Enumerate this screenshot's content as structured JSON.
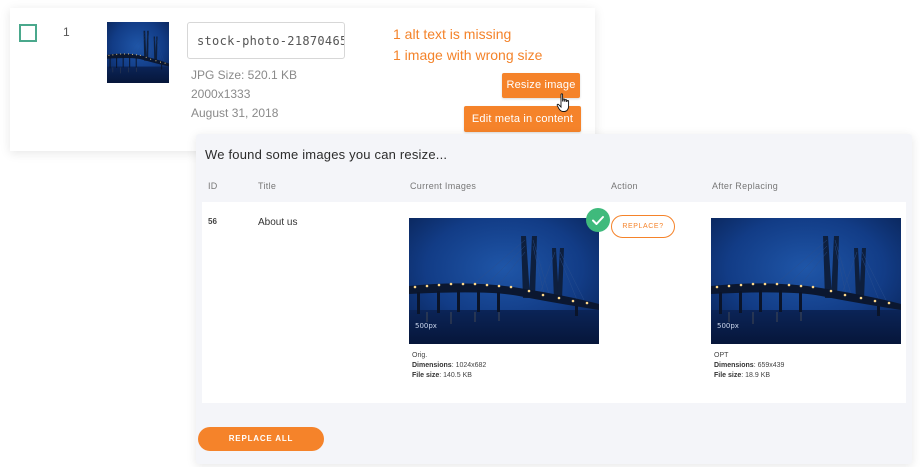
{
  "media_row": {
    "id": "1",
    "filename": "stock-photo-21870465",
    "file_size": "JPG Size: 520.1 KB",
    "dimensions": "2000x1333",
    "date": "August 31, 2018",
    "warnings": [
      "1 alt text is missing",
      "1 image with wrong size"
    ],
    "resize_button": "Resize image",
    "edit_meta_button": "Edit meta in content"
  },
  "resize_panel": {
    "title": "We found some images you can resize...",
    "columns": [
      "ID",
      "Title",
      "Current Images",
      "Action",
      "After Replacing"
    ],
    "row": {
      "id": "56",
      "title": "About us",
      "current": {
        "label": "Orig.",
        "dimensions_label": "Dimensions",
        "dimensions": "1024x682",
        "filesize_label": "File size",
        "filesize": "140.5 KB"
      },
      "action_label": "REPLACE?",
      "after": {
        "label": "OPT",
        "dimensions_label": "Dimensions",
        "dimensions": "659x439",
        "filesize_label": "File size",
        "filesize": "18.9 KB"
      }
    },
    "replace_all_label": "REPLACE ALL",
    "watermark": "500px"
  },
  "colors": {
    "accent_orange": "#f5832a",
    "success_green": "#3fba7c",
    "checkbox_green": "#4aa88c"
  }
}
